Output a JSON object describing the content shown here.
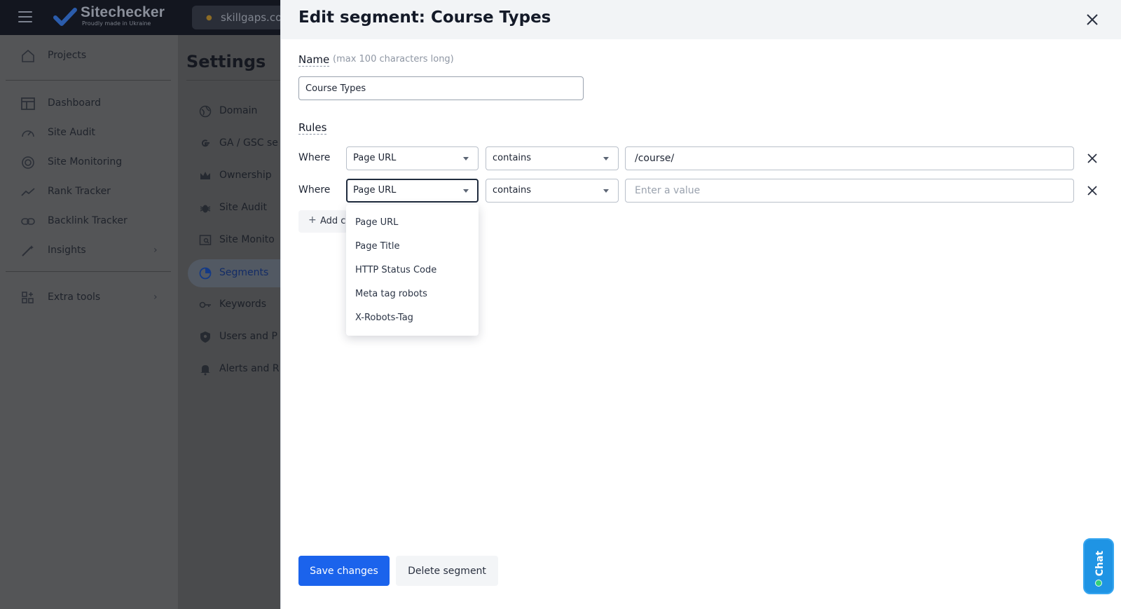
{
  "app": {
    "brand_name": "Sitechecker",
    "brand_tagline": "Proudly made in Ukraine",
    "project_name": "skillgaps.co"
  },
  "sidebar": {
    "items": [
      {
        "label": "Projects",
        "icon": "home-icon"
      },
      {
        "label": "Dashboard",
        "icon": "dashboard-icon"
      },
      {
        "label": "Site Audit",
        "icon": "gauge-icon"
      },
      {
        "label": "Site Monitoring",
        "icon": "radar-icon"
      },
      {
        "label": "Rank Tracker",
        "icon": "trend-line-icon"
      },
      {
        "label": "Backlink Tracker",
        "icon": "link-icon"
      },
      {
        "label": "Insights",
        "icon": "magic-wand-icon",
        "has_submenu": true
      },
      {
        "label": "Extra tools",
        "icon": "grid-plus-icon",
        "has_submenu": true
      }
    ]
  },
  "settings": {
    "title": "Settings",
    "items": [
      {
        "label": "Domain",
        "icon": "globe-icon"
      },
      {
        "label": "GA / GSC se",
        "icon": "google-icon"
      },
      {
        "label": "Ownership",
        "icon": "crown-icon"
      },
      {
        "label": "Site Audit",
        "icon": "bug-icon"
      },
      {
        "label": "Site Monito",
        "icon": "monitor-search-icon"
      },
      {
        "label": "Segments",
        "icon": "pie-chart-icon",
        "active": true
      },
      {
        "label": "Keywords",
        "icon": "key-icon"
      },
      {
        "label": "Users and P",
        "icon": "shield-user-icon"
      },
      {
        "label": "Alerts and R",
        "icon": "bell-icon"
      }
    ]
  },
  "modal": {
    "title": "Edit segment: Course Types",
    "name_label": "Name",
    "name_hint": "(max 100 characters long)",
    "name_value": "Course Types",
    "rules_label": "Rules",
    "rules": [
      {
        "where": "Where",
        "field": "Page URL",
        "operator": "contains",
        "value": "/course/",
        "placeholder": "Enter a value"
      },
      {
        "where": "Where",
        "field": "Page URL",
        "operator": "contains",
        "value": "",
        "placeholder": "Enter a value"
      }
    ],
    "add_condition_label": "Add c",
    "field_options": [
      "Page URL",
      "Page Title",
      "HTTP Status Code",
      "Meta tag robots",
      "X-Robots-Tag"
    ],
    "save_label": "Save changes",
    "delete_label": "Delete segment"
  },
  "chat": {
    "label": "Chat",
    "status_color": "#34d07a"
  },
  "colors": {
    "primary": "#1b63ec",
    "chat": "#1f94e4"
  }
}
